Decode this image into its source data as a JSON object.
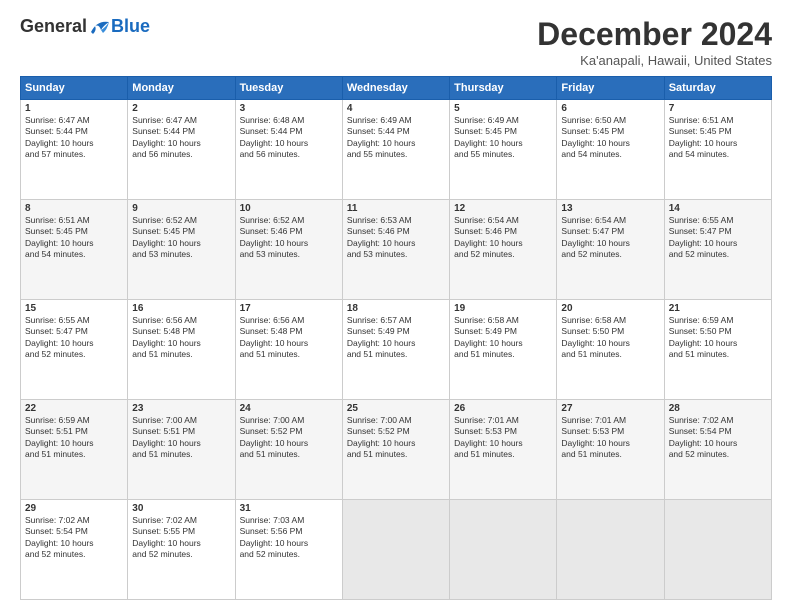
{
  "logo": {
    "general": "General",
    "blue": "Blue"
  },
  "title": "December 2024",
  "subtitle": "Ka'anapali, Hawaii, United States",
  "headers": [
    "Sunday",
    "Monday",
    "Tuesday",
    "Wednesday",
    "Thursday",
    "Friday",
    "Saturday"
  ],
  "weeks": [
    [
      {
        "day": "1",
        "info": "Sunrise: 6:47 AM\nSunset: 5:44 PM\nDaylight: 10 hours\nand 57 minutes."
      },
      {
        "day": "2",
        "info": "Sunrise: 6:47 AM\nSunset: 5:44 PM\nDaylight: 10 hours\nand 56 minutes."
      },
      {
        "day": "3",
        "info": "Sunrise: 6:48 AM\nSunset: 5:44 PM\nDaylight: 10 hours\nand 56 minutes."
      },
      {
        "day": "4",
        "info": "Sunrise: 6:49 AM\nSunset: 5:44 PM\nDaylight: 10 hours\nand 55 minutes."
      },
      {
        "day": "5",
        "info": "Sunrise: 6:49 AM\nSunset: 5:45 PM\nDaylight: 10 hours\nand 55 minutes."
      },
      {
        "day": "6",
        "info": "Sunrise: 6:50 AM\nSunset: 5:45 PM\nDaylight: 10 hours\nand 54 minutes."
      },
      {
        "day": "7",
        "info": "Sunrise: 6:51 AM\nSunset: 5:45 PM\nDaylight: 10 hours\nand 54 minutes."
      }
    ],
    [
      {
        "day": "8",
        "info": "Sunrise: 6:51 AM\nSunset: 5:45 PM\nDaylight: 10 hours\nand 54 minutes."
      },
      {
        "day": "9",
        "info": "Sunrise: 6:52 AM\nSunset: 5:45 PM\nDaylight: 10 hours\nand 53 minutes."
      },
      {
        "day": "10",
        "info": "Sunrise: 6:52 AM\nSunset: 5:46 PM\nDaylight: 10 hours\nand 53 minutes."
      },
      {
        "day": "11",
        "info": "Sunrise: 6:53 AM\nSunset: 5:46 PM\nDaylight: 10 hours\nand 53 minutes."
      },
      {
        "day": "12",
        "info": "Sunrise: 6:54 AM\nSunset: 5:46 PM\nDaylight: 10 hours\nand 52 minutes."
      },
      {
        "day": "13",
        "info": "Sunrise: 6:54 AM\nSunset: 5:47 PM\nDaylight: 10 hours\nand 52 minutes."
      },
      {
        "day": "14",
        "info": "Sunrise: 6:55 AM\nSunset: 5:47 PM\nDaylight: 10 hours\nand 52 minutes."
      }
    ],
    [
      {
        "day": "15",
        "info": "Sunrise: 6:55 AM\nSunset: 5:47 PM\nDaylight: 10 hours\nand 52 minutes."
      },
      {
        "day": "16",
        "info": "Sunrise: 6:56 AM\nSunset: 5:48 PM\nDaylight: 10 hours\nand 51 minutes."
      },
      {
        "day": "17",
        "info": "Sunrise: 6:56 AM\nSunset: 5:48 PM\nDaylight: 10 hours\nand 51 minutes."
      },
      {
        "day": "18",
        "info": "Sunrise: 6:57 AM\nSunset: 5:49 PM\nDaylight: 10 hours\nand 51 minutes."
      },
      {
        "day": "19",
        "info": "Sunrise: 6:58 AM\nSunset: 5:49 PM\nDaylight: 10 hours\nand 51 minutes."
      },
      {
        "day": "20",
        "info": "Sunrise: 6:58 AM\nSunset: 5:50 PM\nDaylight: 10 hours\nand 51 minutes."
      },
      {
        "day": "21",
        "info": "Sunrise: 6:59 AM\nSunset: 5:50 PM\nDaylight: 10 hours\nand 51 minutes."
      }
    ],
    [
      {
        "day": "22",
        "info": "Sunrise: 6:59 AM\nSunset: 5:51 PM\nDaylight: 10 hours\nand 51 minutes."
      },
      {
        "day": "23",
        "info": "Sunrise: 7:00 AM\nSunset: 5:51 PM\nDaylight: 10 hours\nand 51 minutes."
      },
      {
        "day": "24",
        "info": "Sunrise: 7:00 AM\nSunset: 5:52 PM\nDaylight: 10 hours\nand 51 minutes."
      },
      {
        "day": "25",
        "info": "Sunrise: 7:00 AM\nSunset: 5:52 PM\nDaylight: 10 hours\nand 51 minutes."
      },
      {
        "day": "26",
        "info": "Sunrise: 7:01 AM\nSunset: 5:53 PM\nDaylight: 10 hours\nand 51 minutes."
      },
      {
        "day": "27",
        "info": "Sunrise: 7:01 AM\nSunset: 5:53 PM\nDaylight: 10 hours\nand 51 minutes."
      },
      {
        "day": "28",
        "info": "Sunrise: 7:02 AM\nSunset: 5:54 PM\nDaylight: 10 hours\nand 52 minutes."
      }
    ],
    [
      {
        "day": "29",
        "info": "Sunrise: 7:02 AM\nSunset: 5:54 PM\nDaylight: 10 hours\nand 52 minutes."
      },
      {
        "day": "30",
        "info": "Sunrise: 7:02 AM\nSunset: 5:55 PM\nDaylight: 10 hours\nand 52 minutes."
      },
      {
        "day": "31",
        "info": "Sunrise: 7:03 AM\nSunset: 5:56 PM\nDaylight: 10 hours\nand 52 minutes."
      },
      {
        "day": "",
        "info": ""
      },
      {
        "day": "",
        "info": ""
      },
      {
        "day": "",
        "info": ""
      },
      {
        "day": "",
        "info": ""
      }
    ]
  ]
}
